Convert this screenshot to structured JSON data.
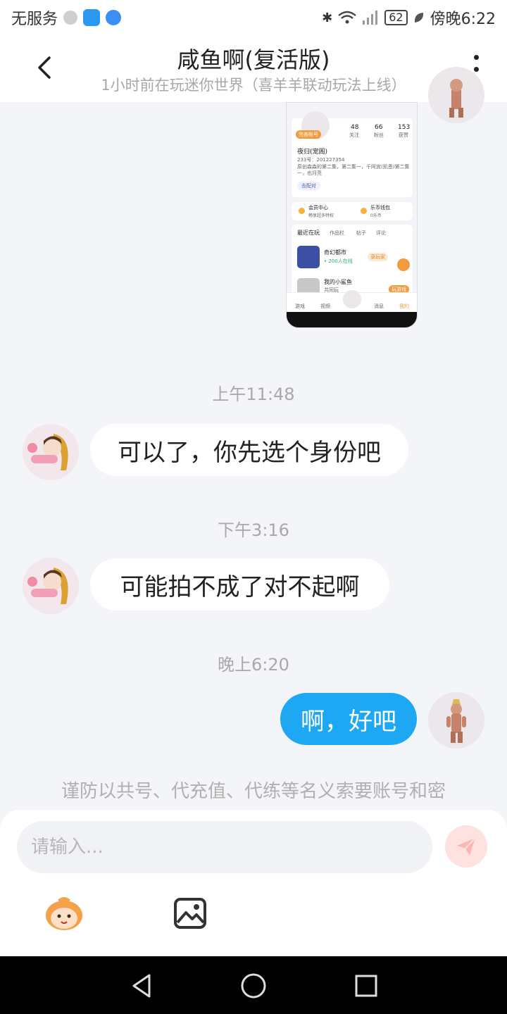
{
  "status_bar": {
    "carrier": "无服务",
    "battery": "62",
    "time": "傍晚6:22"
  },
  "header": {
    "title": "咸鱼啊(复活版)",
    "subtitle": "1小时前在玩迷你世界（喜羊羊联动玩法上线）"
  },
  "shared_screenshot": {
    "complete_badge": "完善账号",
    "stats": [
      {
        "value": "48",
        "label": "关注"
      },
      {
        "value": "66",
        "label": "粉丝"
      },
      {
        "value": "153",
        "label": "获赞"
      }
    ],
    "name": "夜归(宠阁)",
    "id_line": "233号：201227354",
    "bio": "原创森森的第二集，第二集一，千阿宾(凯恩)第二集一，也月亮",
    "pair_button": "去配对",
    "vip_title": "会员中心",
    "vip_sub": "畅享超多特权",
    "coin_title": "乐币钱包",
    "coin_sub": "0乐币",
    "tabs": [
      "最近在玩",
      "作品栏",
      "帖子",
      "评论"
    ],
    "games": [
      {
        "name": "奇幻都市",
        "sub": "• 200人在线",
        "tag": "录玩家"
      },
      {
        "name": "我的小鲨鱼",
        "sub": "共同玩",
        "tag": "玩游戏"
      }
    ],
    "bottom_tabs": [
      "游戏",
      "视频",
      "",
      "消息",
      "我的"
    ]
  },
  "messages": [
    {
      "timestamp": "上午11:48",
      "text": "可以了，你先选个身份吧",
      "from": "other"
    },
    {
      "timestamp": "下午3:16",
      "text": "可能拍不成了对不起啊",
      "from": "other"
    },
    {
      "timestamp": "晚上6:20",
      "text": "啊，好吧",
      "from": "me"
    }
  ],
  "notice": "谨防以共号、代充值、代练等名义索要账号和密",
  "input": {
    "placeholder": "请输入..."
  },
  "colors": {
    "accent": "#1ea7f2",
    "orange": "#f29a3d"
  },
  "icons": {
    "back": "chevron-left-icon",
    "more": "more-vertical-icon",
    "send": "send-icon",
    "emoji": "emoji-icon",
    "image": "image-icon"
  }
}
